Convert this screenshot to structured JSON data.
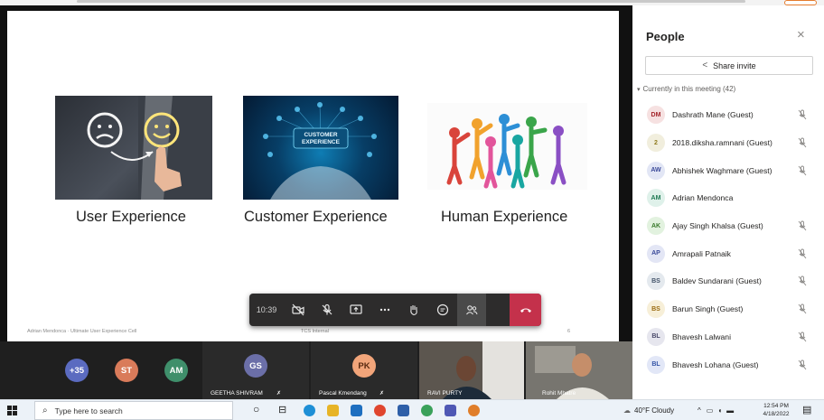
{
  "slide": {
    "captions": [
      "User Experience",
      "Customer Experience",
      "Human Experience"
    ],
    "badge_text": "CUSTOMER\nEXPERIENCE",
    "footer_left": "Adrian Mendonca · Ultimate User Experience Cell",
    "footer_mid": "TCS Internal",
    "footer_page": "6"
  },
  "toolbar": {
    "time": "10:39",
    "buttons": [
      "camera-off-icon",
      "mic-off-icon",
      "share-screen-icon",
      "more-icon",
      "raise-hand-icon",
      "chat-icon",
      "participants-icon"
    ],
    "hangup_icon": "hang-up-icon"
  },
  "people": {
    "title": "People",
    "close": "×",
    "share_label": "Share invite",
    "in_meeting": "Currently in this meeting (42)",
    "list": [
      {
        "initials": "DM",
        "name": "Dashrath Mane (Guest)",
        "bg": "#f6e1e1",
        "fg": "#a4262c"
      },
      {
        "initials": "2",
        "name": "2018.diksha.ramnani (Guest)",
        "bg": "#f1eedd",
        "fg": "#8f7a1c"
      },
      {
        "initials": "AW",
        "name": "Abhishek Waghmare (Guest)",
        "bg": "#e2e6f5",
        "fg": "#3b4a9a"
      },
      {
        "initials": "AM",
        "name": "Adrian Mendonca",
        "bg": "#dff1ea",
        "fg": "#1f7a54"
      },
      {
        "initials": "AK",
        "name": "Ajay Singh Khalsa (Guest)",
        "bg": "#e2f2df",
        "fg": "#3a7a2c"
      },
      {
        "initials": "AP",
        "name": "Amrapali Patnaik",
        "bg": "#e3e6f5",
        "fg": "#3b4a9a"
      },
      {
        "initials": "BS",
        "name": "Baldev Sundarani (Guest)",
        "bg": "#e4e9ee",
        "fg": "#44546a"
      },
      {
        "initials": "BS",
        "name": "Barun Singh (Guest)",
        "bg": "#f7efd8",
        "fg": "#9a6b10"
      },
      {
        "initials": "BL",
        "name": "Bhavesh Lalwani",
        "bg": "#e6e6ee",
        "fg": "#4a4a6a"
      },
      {
        "initials": "BL",
        "name": "Bhavesh Lohana (Guest)",
        "bg": "#e2e7f7",
        "fg": "#3656a8"
      }
    ]
  },
  "strip": {
    "tiles": [
      {
        "label": "+35",
        "bg": "#5b6bc0"
      },
      {
        "label": "ST",
        "bg": "#d97b5a"
      },
      {
        "label": "AM",
        "bg": "#3f8f6b"
      }
    ],
    "gs": {
      "initials": "GS",
      "name": "GEETHA SHIVRAM",
      "bg": "#6b6fa8"
    },
    "pk": {
      "initials": "PK",
      "name": "Pascal Kmendang",
      "bg": "#f2a57a"
    },
    "video1_name": "RAVI PURTY",
    "video2_name": "Rohit Mhatre"
  },
  "taskbar": {
    "search_placeholder": "Type here to search",
    "weather": "40°F  Cloudy",
    "time": "12:54 PM",
    "date": "4/18/2022"
  }
}
